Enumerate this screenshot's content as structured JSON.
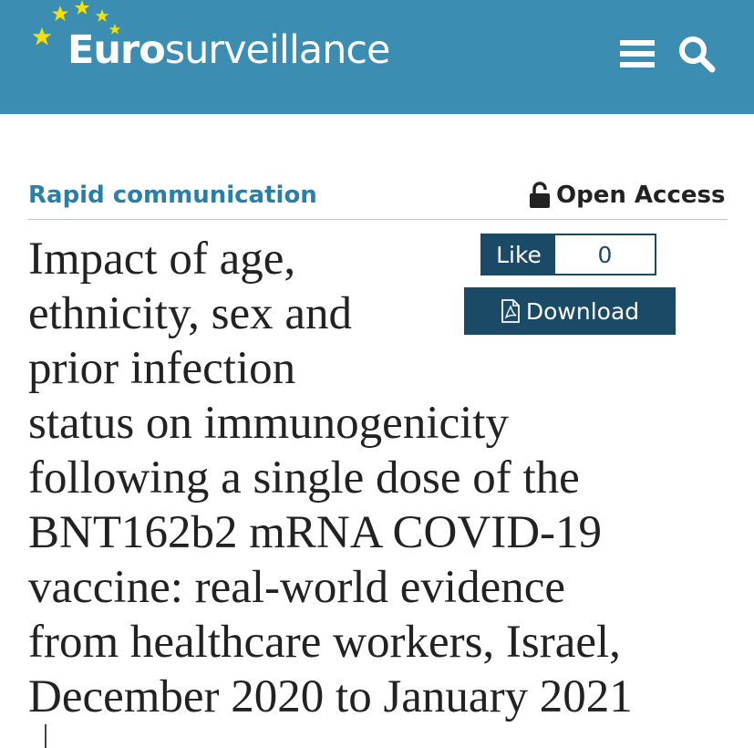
{
  "header": {
    "logo_prefix": "Euro",
    "logo_suffix": "surveillance",
    "background_color": "#3b8db1",
    "menu_icon": "hamburger-menu-icon",
    "search_icon": "search-icon"
  },
  "article": {
    "type_label": "Rapid communication",
    "access_label": "Open Access",
    "access_icon": "unlocked-padlock-icon",
    "title_lines": [
      "Impact of age,",
      "ethnicity, sex and",
      "prior infection",
      "status on immunogenicity",
      "following a single dose of the",
      "BNT162b2 mRNA COVID-19",
      "vaccine: real-world evidence",
      "from healthcare workers, Israel,",
      "December 2020 to January 2021"
    ]
  },
  "actions": {
    "like_label": "Like",
    "like_count": "0",
    "download_label": "Download",
    "download_icon": "pdf-file-icon",
    "accent_color": "#1b4a66"
  }
}
